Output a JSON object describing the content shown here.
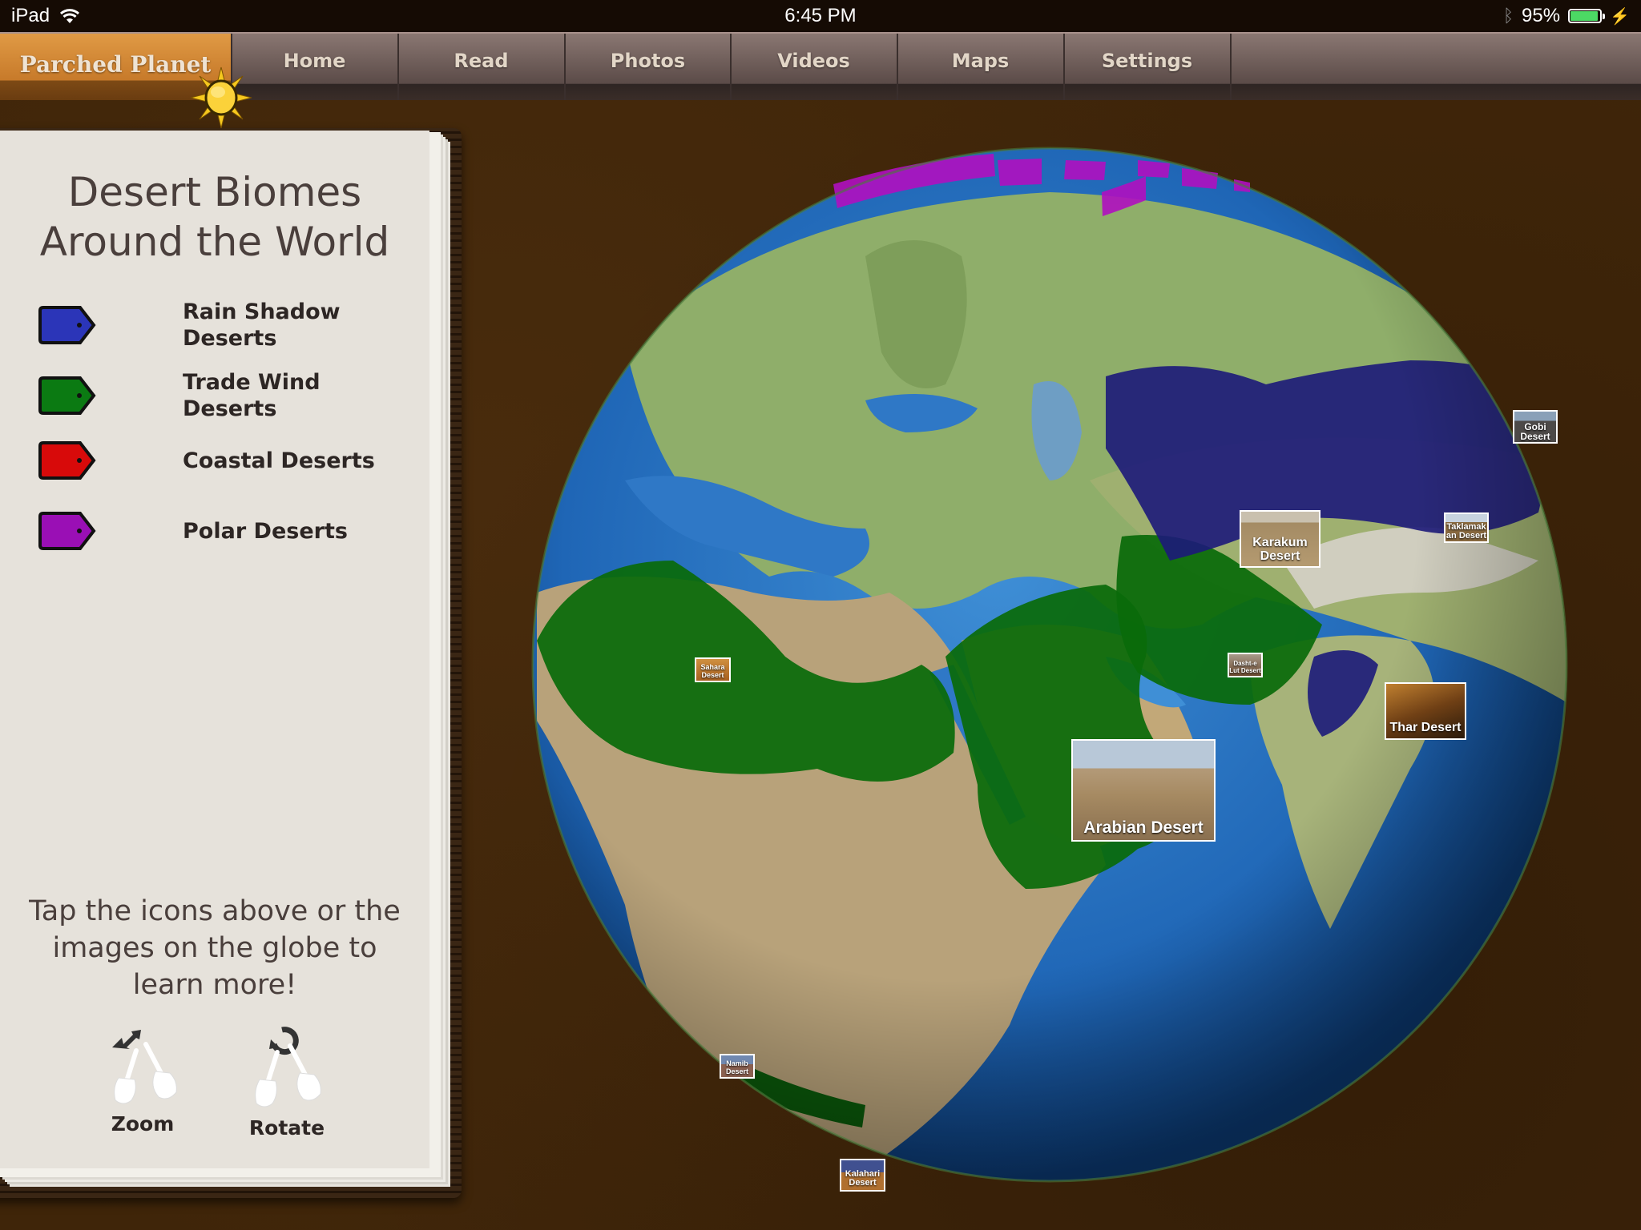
{
  "status_bar": {
    "device": "iPad",
    "time": "6:45 PM",
    "battery_percent_label": "95%",
    "battery_level": 0.95,
    "icons": [
      "wifi-icon",
      "bluetooth-icon",
      "battery-icon",
      "charging-bolt-icon"
    ]
  },
  "nav": {
    "brand": "Parched Planet",
    "tabs": [
      {
        "label": "Home"
      },
      {
        "label": "Read"
      },
      {
        "label": "Photos"
      },
      {
        "label": "Videos"
      },
      {
        "label": "Maps"
      },
      {
        "label": "Settings"
      }
    ]
  },
  "panel": {
    "title_line1": "Desert Biomes",
    "title_line2": "Around the World",
    "legend": [
      {
        "line1": "Rain Shadow",
        "line2": "Deserts",
        "color": "#2b35b8"
      },
      {
        "line1": "Trade Wind",
        "line2": "Deserts",
        "color": "#0b7a12"
      },
      {
        "line1": "Coastal Deserts",
        "line2": "",
        "color": "#d80a0a"
      },
      {
        "line1": "Polar Deserts",
        "line2": "",
        "color": "#9a0fb5"
      }
    ],
    "help_line1": "Tap the icons above or the",
    "help_line2": "images on the globe to",
    "help_line3": "learn more!",
    "gestures": [
      {
        "label": "Zoom",
        "icon": "pinch-zoom-icon"
      },
      {
        "label": "Rotate",
        "icon": "two-finger-rotate-icon"
      }
    ]
  },
  "globe": {
    "overlay_colors": {
      "rain_shadow": "#1c1a7a",
      "trade_wind": "#0a6a0a",
      "coastal": "#c01010",
      "polar": "#b010c0"
    },
    "markers": [
      {
        "line1": "Gobi",
        "line2": "Desert",
        "type": "rain_shadow"
      },
      {
        "line1": "Taklamak",
        "line2": "an Desert",
        "type": "rain_shadow"
      },
      {
        "line1": "Karakum",
        "line2": "Desert",
        "type": "rain_shadow"
      },
      {
        "line1": "Dasht-e",
        "line2": "Lut Desert",
        "type": "trade_wind"
      },
      {
        "line1": "Thar Desert",
        "line2": "",
        "type": "rain_shadow"
      },
      {
        "line1": "Arabian Desert",
        "line2": "",
        "type": "trade_wind"
      },
      {
        "line1": "Sahara",
        "line2": "Desert",
        "type": "trade_wind"
      },
      {
        "line1": "Namib",
        "line2": "Desert",
        "type": "coastal"
      },
      {
        "line1": "Kalahari",
        "line2": "Desert",
        "type": "trade_wind"
      }
    ]
  }
}
